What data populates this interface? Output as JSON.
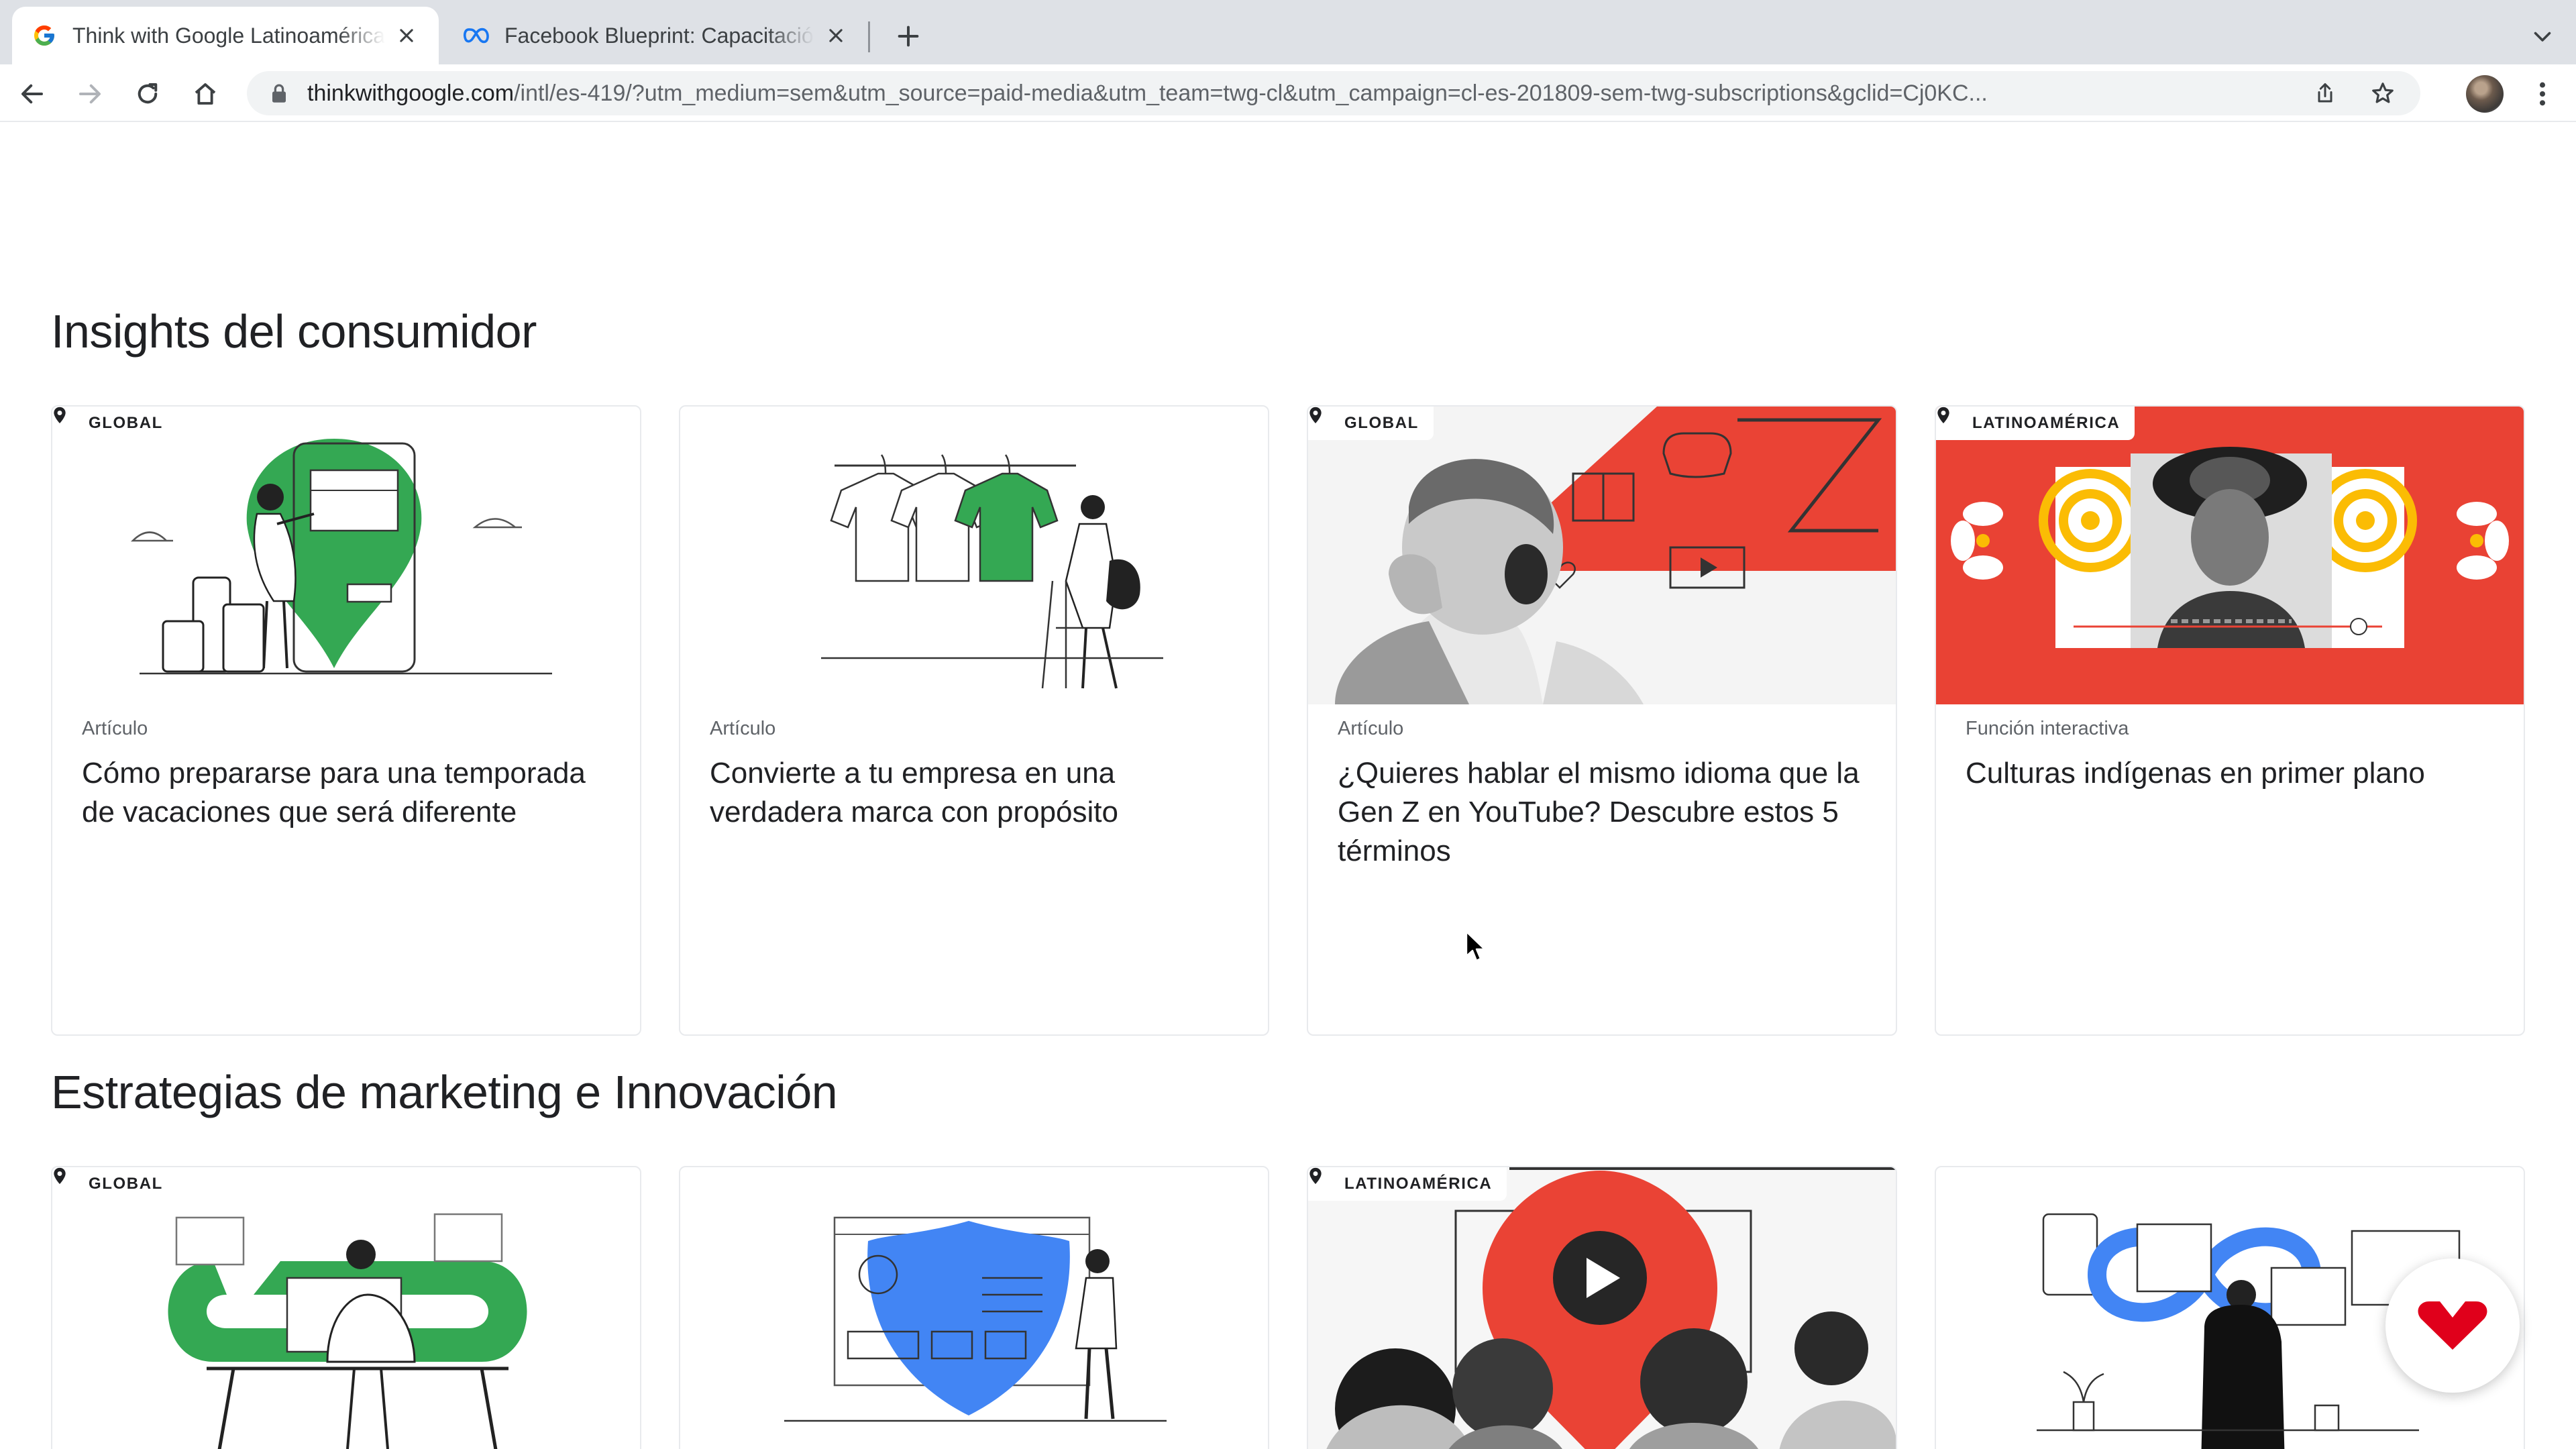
{
  "browser": {
    "tabs": [
      {
        "title": "Think with Google Latinoamérica",
        "favicon": "google-g-icon",
        "active": true
      },
      {
        "title": "Facebook Blueprint: Capacitación",
        "favicon": "meta-infinity-icon",
        "active": false
      }
    ],
    "url": {
      "host": "thinkwithgoogle.com",
      "path": "/intl/es-419/?utm_medium=sem&utm_source=paid-media&utm_team=twg-cl&utm_campaign=cl-es-201809-sem-twg-subscriptions&gclid=Cj0KC..."
    }
  },
  "colors": {
    "google_green": "#34a853",
    "google_red": "#ea4335",
    "google_blue": "#4285f4",
    "google_yellow": "#fbbc04",
    "chip_red": "#e0001b"
  },
  "sections": [
    {
      "title": "Insights del consumidor",
      "cards": [
        {
          "badge": "GLOBAL",
          "kind": "Artículo",
          "title": "Cómo prepararse para una temporada de vacaciones que será diferente"
        },
        {
          "badge": "",
          "kind": "Artículo",
          "title": "Convierte a tu empresa en una verdadera marca con propósito"
        },
        {
          "badge": "GLOBAL",
          "kind": "Artículo",
          "title": "¿Quieres hablar el mismo idioma que la Gen Z en YouTube? Descubre estos 5 términos"
        },
        {
          "badge": "LATINOAMÉRICA",
          "kind": "Función interactiva",
          "title": "Culturas indígenas en primer plano"
        }
      ]
    },
    {
      "title": "Estrategias de marketing e Innovación",
      "cards": [
        {
          "badge": "GLOBAL"
        },
        {
          "badge": ""
        },
        {
          "badge": "LATINOAMÉRICA"
        },
        {
          "badge": ""
        }
      ]
    }
  ]
}
